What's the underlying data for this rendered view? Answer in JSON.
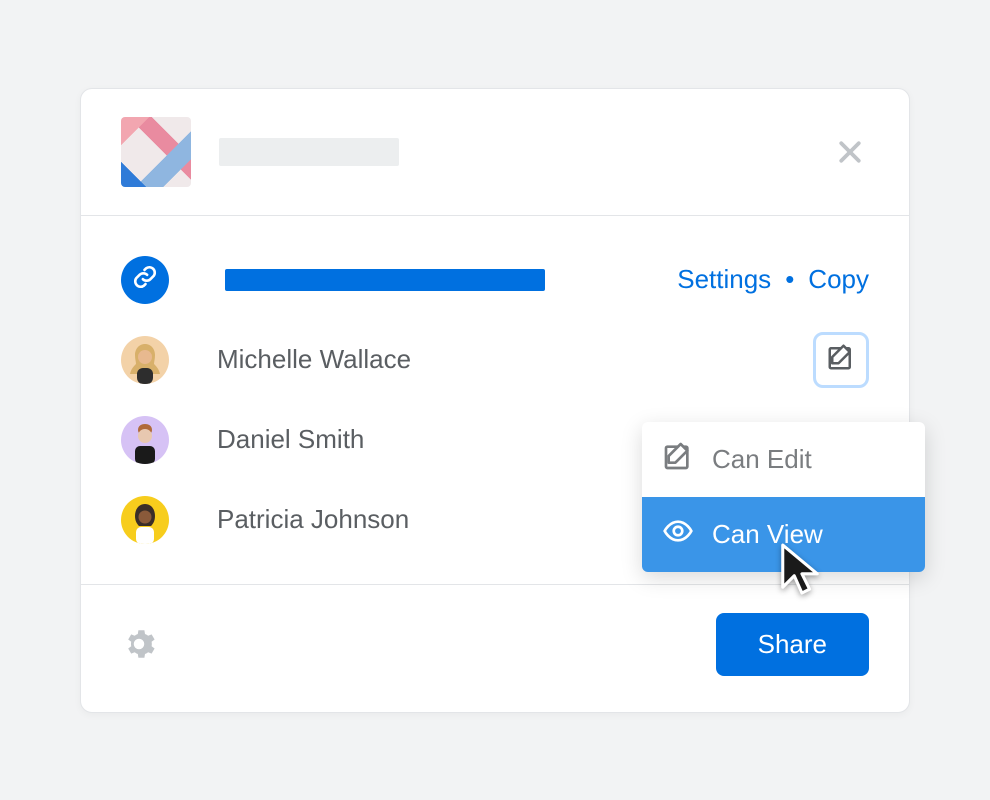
{
  "link_row": {
    "settings_label": "Settings",
    "separator": "•",
    "copy_label": "Copy"
  },
  "people": [
    {
      "name": "Michelle Wallace",
      "permission_icon": "edit",
      "active": true,
      "avatar_bg": "#f3d2a8",
      "avatar_hair": "#d8b06a"
    },
    {
      "name": "Daniel Smith",
      "permission_icon": "none",
      "active": false,
      "avatar_bg": "#d6c2f5",
      "avatar_hair": "#b06a3a"
    },
    {
      "name": "Patricia Johnson",
      "permission_icon": "view",
      "active": false,
      "avatar_bg": "#f7cd1d",
      "avatar_hair": "#3a2e28"
    }
  ],
  "dropdown": {
    "items": [
      {
        "label": "Can Edit",
        "icon": "edit",
        "selected": false
      },
      {
        "label": "Can View",
        "icon": "view",
        "selected": true
      }
    ]
  },
  "footer": {
    "share_label": "Share"
  },
  "colors": {
    "accent": "#0070e0",
    "accent_light": "#3a95e8",
    "focus_ring": "#bcdcff",
    "text_muted": "#5a5e62",
    "icon_muted": "#c0c4c8"
  }
}
